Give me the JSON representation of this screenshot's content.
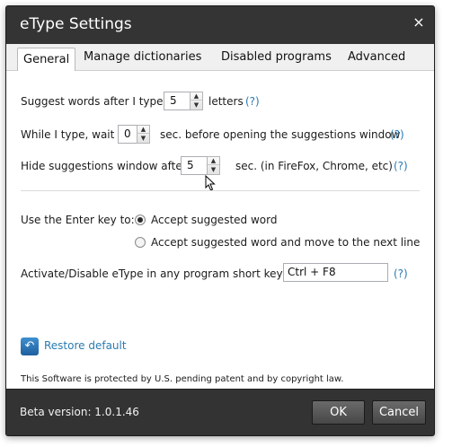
{
  "window": {
    "title": "eType Settings",
    "close_glyph": "×"
  },
  "tabs": [
    {
      "label": "General",
      "active": true
    },
    {
      "label": "Manage dictionaries"
    },
    {
      "label": "Disabled programs"
    },
    {
      "label": "Advanced"
    }
  ],
  "general": {
    "suggest": {
      "before": "Suggest words after I type",
      "value": "5",
      "after": "letters",
      "help": "(?)"
    },
    "wait": {
      "before": "While I type, wait",
      "value": "0",
      "after": "sec. before opening the suggestions window",
      "help": "(?)"
    },
    "hide": {
      "before": "Hide suggestions window after",
      "value": "5",
      "after": "sec. (in FireFox, Chrome, etc)",
      "help": "(?)"
    },
    "enter_key": {
      "label": "Use the Enter key to:",
      "options": [
        {
          "label": "Accept suggested word",
          "checked": true
        },
        {
          "label": "Accept suggested word and move to the next line",
          "checked": false
        }
      ]
    },
    "shortcut": {
      "label": "Activate/Disable eType in any program short key:",
      "value": "Ctrl + F8",
      "help": "(?)"
    },
    "restore": {
      "label": "Restore default",
      "icon": "restore-arrow-icon"
    },
    "notice": "This Software is protected by U.S. pending patent and by copyright law."
  },
  "footer": {
    "version": "Beta version: 1.0.1.46",
    "ok_label": "OK",
    "cancel_label": "Cancel"
  },
  "colors": {
    "chrome_dark": "#333333",
    "link_blue": "#2a7ab0"
  }
}
